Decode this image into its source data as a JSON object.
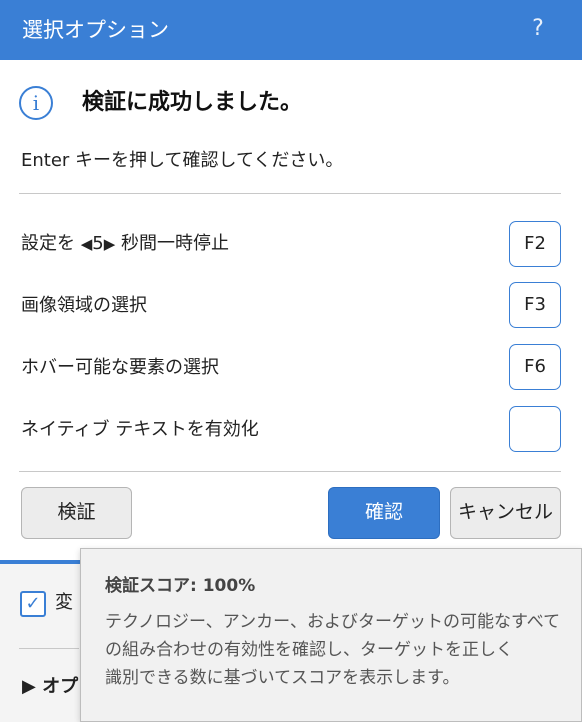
{
  "window": {
    "title": "選択オプション",
    "help_label": "?"
  },
  "message": {
    "icon": "info-icon",
    "title": "検証に成功しました。",
    "instruction": "Enter キーを押して確認してください。"
  },
  "options": [
    {
      "label_prefix": "設定を ",
      "left_arrow": "◀",
      "delay_value": "5",
      "right_arrow": "▶",
      "label_suffix": " 秒間一時停止",
      "hotkey": "F2"
    },
    {
      "label": "画像領域の選択",
      "hotkey": "F3"
    },
    {
      "label": "ホバー可能な要素の選択",
      "hotkey": "F6"
    },
    {
      "label": "ネイティブ テキストを有効化",
      "hotkey": ""
    }
  ],
  "buttons": {
    "verify": "検証",
    "confirm": "確認",
    "cancel": "キャンセル"
  },
  "background": {
    "checkbox_label": "変",
    "checkbox_checked": true,
    "section_label": "▶ オプ"
  },
  "tooltip": {
    "title": "検証スコア: 100%",
    "lines": [
      "テクノロジー、アンカー、およびターゲットの可能なすべて",
      "の組み合わせの有効性を確認し、ターゲットを正しく",
      "識別できる数に基づいてスコアを表示します。"
    ]
  },
  "colors": {
    "accent": "#3a7fd5",
    "button_gray": "#ececec",
    "tooltip_bg": "#f1f1f1"
  }
}
